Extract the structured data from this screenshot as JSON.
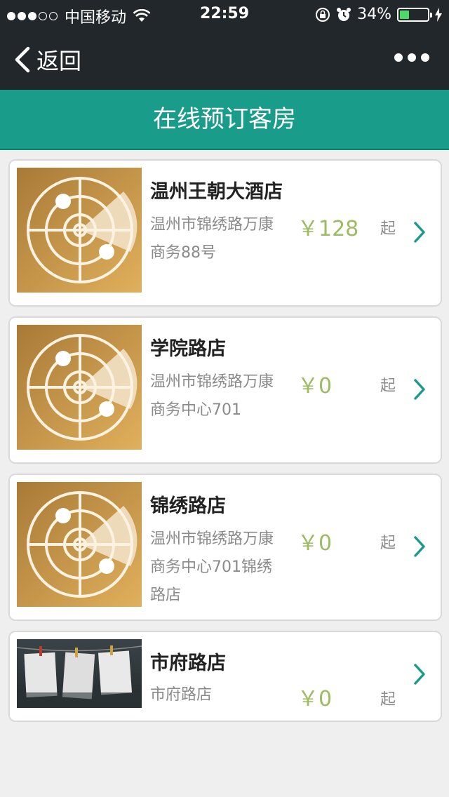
{
  "status_bar": {
    "carrier": "中国移动",
    "time": "22:59",
    "battery": "34%",
    "battery_level": 0.34
  },
  "nav": {
    "back_label": "返回"
  },
  "title": "在线预订客房",
  "hotels": [
    {
      "name": "温州王朝大酒店",
      "address": "温州市锦绣路万康商务88号",
      "price": "￥128",
      "suffix": "起",
      "image": "radar-icon"
    },
    {
      "name": "学院路店",
      "address": "温州市锦绣路万康商务中心701",
      "price": "￥0",
      "suffix": "起",
      "image": "radar-icon"
    },
    {
      "name": "锦绣路店",
      "address": "温州市锦绣路万康商务中心701锦绣路店",
      "price": "￥0",
      "suffix": "起",
      "image": "radar-icon"
    },
    {
      "name": "市府路店",
      "address": "市府路店",
      "price": "￥0",
      "suffix": "起",
      "image": "photo-papers"
    }
  ],
  "colors": {
    "header_bg": "#21272a",
    "title_bg": "#1a9c8a",
    "price": "#9dbb62",
    "chevron": "#1a9c8a"
  }
}
